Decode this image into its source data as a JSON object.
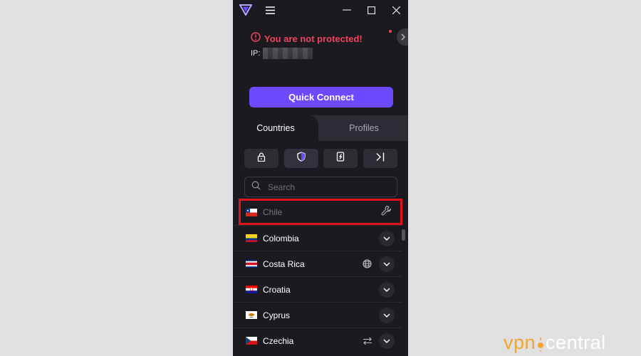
{
  "app": {
    "status": "You are not protected!",
    "ip_label": "IP:",
    "quick_connect": "Quick Connect",
    "colors": {
      "accent": "#6d4aff",
      "danger": "#f0435b",
      "background": "#1b1a21"
    }
  },
  "tabs": [
    {
      "label": "Countries",
      "active": true
    },
    {
      "label": "Profiles",
      "active": false
    }
  ],
  "filters": [
    {
      "icon": "lock-icon"
    },
    {
      "icon": "shield-icon",
      "active": true
    },
    {
      "icon": "p2p-icon"
    },
    {
      "icon": "tor-icon"
    }
  ],
  "search": {
    "placeholder": "Search"
  },
  "countries": [
    {
      "name": "Chile",
      "flag": "chile-flag",
      "state": "maintenance"
    },
    {
      "name": "Colombia",
      "flag": "colombia-flag"
    },
    {
      "name": "Costa Rica",
      "flag": "costa-rica-flag",
      "feature": "globe-icon"
    },
    {
      "name": "Croatia",
      "flag": "croatia-flag"
    },
    {
      "name": "Cyprus",
      "flag": "cyprus-flag"
    },
    {
      "name": "Czechia",
      "flag": "czechia-flag",
      "feature": "arrows-swap-icon"
    }
  ],
  "watermark": {
    "part1": "vpn",
    "part2": "central"
  }
}
